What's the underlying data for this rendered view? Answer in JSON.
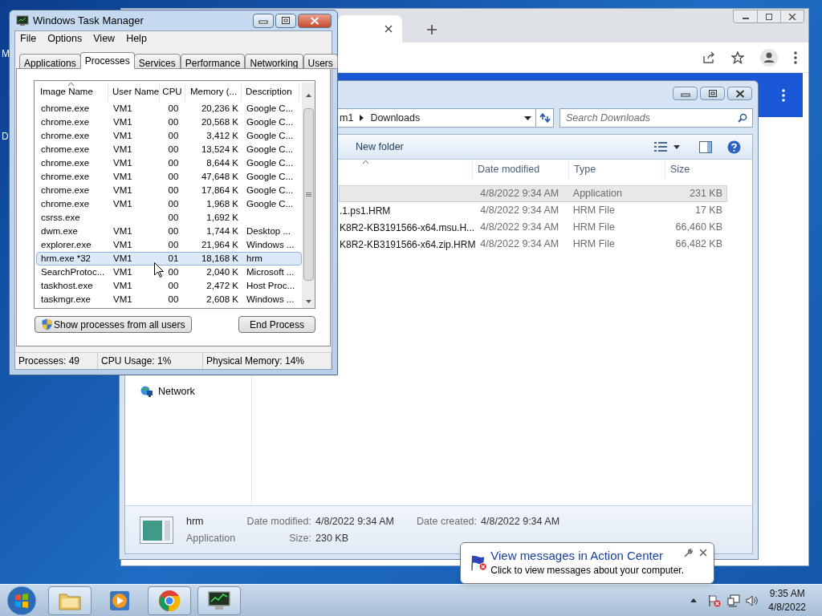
{
  "desktop_icons": [
    {
      "label": "M"
    },
    {
      "label": "D"
    }
  ],
  "explorer": {
    "address": [
      "m1",
      "Downloads"
    ],
    "search": {
      "placeholder": "Search Downloads"
    },
    "toolbar": [
      "New folder"
    ],
    "columns": [
      "Date modified",
      "Type",
      "Size"
    ],
    "files": [
      {
        "date": "4/8/2022 9:34 AM",
        "type": "Application",
        "size": "231 KB",
        "selected": true
      },
      {
        "name": ".1.ps1.HRM",
        "date": "4/8/2022 9:34 AM",
        "type": "HRM File",
        "size": "17 KB",
        "selected": false
      },
      {
        "name": "K8R2-KB3191566-x64.msu.H...",
        "date": "4/8/2022 9:34 AM",
        "type": "HRM File",
        "size": "66,460 KB",
        "selected": false
      },
      {
        "name": "K8R2-KB3191566-x64.zip.HRM",
        "date": "4/8/2022 9:34 AM",
        "type": "HRM File",
        "size": "66,482 KB",
        "selected": false
      }
    ],
    "nav": [
      {
        "label": "Network"
      }
    ],
    "details": {
      "name": "hrm",
      "type": "Application",
      "modified_label": "Date modified:",
      "modified": "4/8/2022 9:34 AM",
      "size_label": "Size:",
      "size": "230 KB",
      "created_label": "Date created:",
      "created": "4/8/2022 9:34 AM"
    }
  },
  "task_manager": {
    "title": "Windows Task Manager",
    "menu": [
      "File",
      "Options",
      "View",
      "Help"
    ],
    "tabs": [
      {
        "label": "Applications",
        "selected": false
      },
      {
        "label": "Processes",
        "selected": true
      },
      {
        "label": "Services",
        "selected": false
      },
      {
        "label": "Performance",
        "selected": false
      },
      {
        "label": "Networking",
        "selected": false
      },
      {
        "label": "Users",
        "selected": false
      }
    ],
    "columns": [
      "Image Name",
      "User Name",
      "CPU",
      "Memory (...",
      "Description"
    ],
    "rows": [
      {
        "cells": [
          "chrome.exe",
          "VM1",
          "00",
          "20,236 K",
          "Google C..."
        ],
        "selected": false
      },
      {
        "cells": [
          "chrome.exe",
          "VM1",
          "00",
          "20,568 K",
          "Google C..."
        ],
        "selected": false
      },
      {
        "cells": [
          "chrome.exe",
          "VM1",
          "00",
          "3,412 K",
          "Google C..."
        ],
        "selected": false
      },
      {
        "cells": [
          "chrome.exe",
          "VM1",
          "00",
          "13,524 K",
          "Google C..."
        ],
        "selected": false
      },
      {
        "cells": [
          "chrome.exe",
          "VM1",
          "00",
          "8,644 K",
          "Google C..."
        ],
        "selected": false
      },
      {
        "cells": [
          "chrome.exe",
          "VM1",
          "00",
          "47,648 K",
          "Google C..."
        ],
        "selected": false
      },
      {
        "cells": [
          "chrome.exe",
          "VM1",
          "00",
          "17,864 K",
          "Google C..."
        ],
        "selected": false
      },
      {
        "cells": [
          "chrome.exe",
          "VM1",
          "00",
          "1,968 K",
          "Google C..."
        ],
        "selected": false
      },
      {
        "cells": [
          "csrss.exe",
          "",
          "00",
          "1,692 K",
          ""
        ],
        "selected": false
      },
      {
        "cells": [
          "dwm.exe",
          "VM1",
          "00",
          "1,744 K",
          "Desktop ..."
        ],
        "selected": false
      },
      {
        "cells": [
          "explorer.exe",
          "VM1",
          "00",
          "21,964 K",
          "Windows ..."
        ],
        "selected": false
      },
      {
        "cells": [
          "hrm.exe *32",
          "VM1",
          "01",
          "18,168 K",
          "hrm"
        ],
        "selected": true
      },
      {
        "cells": [
          "SearchProtoc...",
          "VM1",
          "00",
          "2,040 K",
          "Microsoft ..."
        ],
        "selected": false
      },
      {
        "cells": [
          "taskhost.exe",
          "VM1",
          "00",
          "2,472 K",
          "Host Proc..."
        ],
        "selected": false
      },
      {
        "cells": [
          "taskmgr.exe",
          "VM1",
          "00",
          "2,608 K",
          "Windows ..."
        ],
        "selected": false
      }
    ],
    "buttons": [
      "Show processes from all users",
      "End Process"
    ],
    "status": [
      "Processes: 49",
      "CPU Usage: 1%",
      "Physical Memory: 14%"
    ]
  },
  "notification": {
    "title": "View messages in Action Center",
    "text": "Click to view messages about your computer."
  },
  "taskbar": {
    "apps": [
      {
        "kind": "folder",
        "running": true
      },
      {
        "kind": "media",
        "running": false
      },
      {
        "kind": "chrome",
        "running": true
      },
      {
        "kind": "monitor",
        "running": true
      }
    ],
    "clock": {
      "time": "9:35 AM",
      "date": "4/8/2022"
    }
  }
}
